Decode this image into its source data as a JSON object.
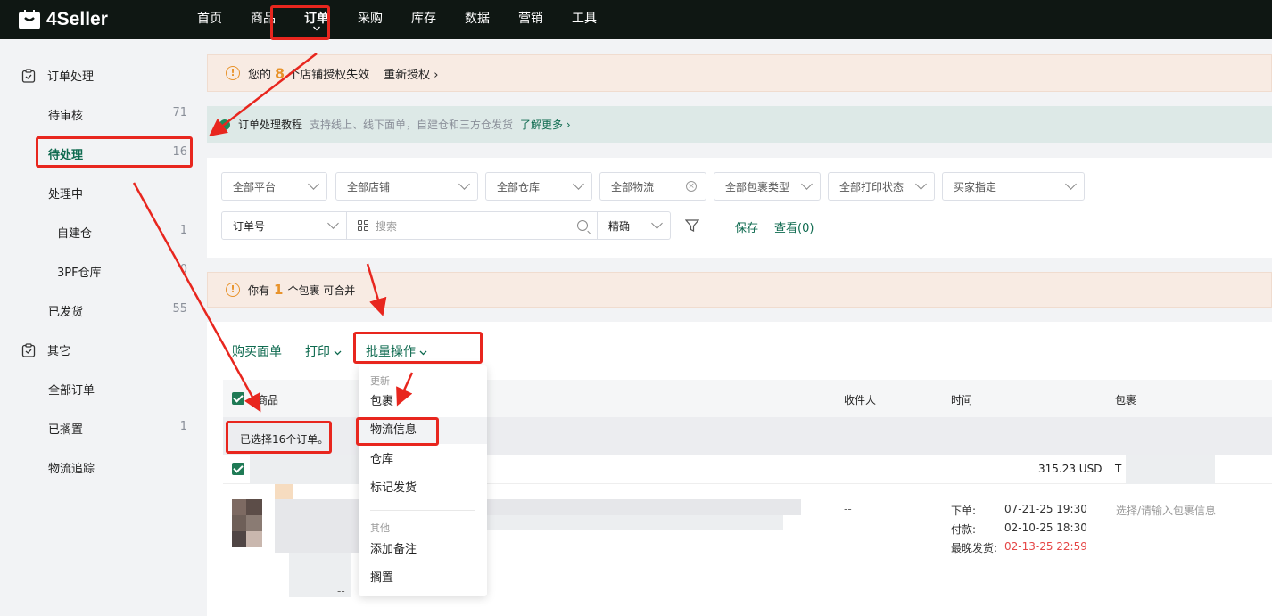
{
  "app": {
    "logo_text": "4Seller"
  },
  "nav": {
    "items": [
      "首页",
      "商品",
      "订单",
      "采购",
      "库存",
      "数据",
      "营销",
      "工具"
    ],
    "active_index": 2
  },
  "sidebar": {
    "group1": "订单处理",
    "items1": [
      {
        "label": "待审核",
        "count": "71"
      },
      {
        "label": "待处理",
        "count": "16"
      },
      {
        "label": "处理中",
        "count": ""
      },
      {
        "label": "自建仓",
        "count": "1"
      },
      {
        "label": "3PF仓库",
        "count": "0"
      },
      {
        "label": "已发货",
        "count": "55"
      }
    ],
    "group2": "其它",
    "items2": [
      {
        "label": "全部订单",
        "count": ""
      },
      {
        "label": "已搁置",
        "count": "1"
      },
      {
        "label": "物流追踪",
        "count": ""
      }
    ]
  },
  "banner_auth": {
    "prefix": "您的",
    "number": "8",
    "suffix": "个店铺授权失效",
    "link": "重新授权 ›"
  },
  "banner_tutorial": {
    "title": "订单处理教程",
    "subtitle": "支持线上、线下面单，自建仓和三方仓发货",
    "link": "了解更多 ›"
  },
  "filters": {
    "platform": "全部平台",
    "store": "全部店铺",
    "warehouse": "全部仓库",
    "logistics": "全部物流",
    "package_type": "全部包裹类型",
    "print_status": "全部打印状态",
    "buyer_specified": "买家指定",
    "search_field": "订单号",
    "search_placeholder": "搜索",
    "match_mode": "精确",
    "save": "保存",
    "view": "查看(0)"
  },
  "banner_merge": {
    "prefix": "你有",
    "number": "1",
    "suffix": "个包裹 可合并"
  },
  "actions": {
    "buy_label": "购买面单",
    "print": "打印",
    "batch": "批量操作"
  },
  "table": {
    "headers": {
      "product": "商品",
      "recipient": "收件人",
      "time": "时间",
      "package": "包裹"
    },
    "selected_note": "已选择16个订单。",
    "order": {
      "amount": "315.23 USD",
      "amount_tail": "T",
      "recipient": "--",
      "product_tail": "--",
      "time_labels": [
        "下单:",
        "付款:",
        "最晚发货:"
      ],
      "time_values": [
        "07-21-25 19:30",
        "02-10-25 18:30",
        "02-13-25 22:59"
      ],
      "package_info": "选择/请输入包裹信息"
    }
  },
  "batch_menu": {
    "group_update": "更新",
    "update_items": [
      "包裹",
      "物流信息",
      "仓库",
      "标记发货"
    ],
    "group_other": "其他",
    "other_items": [
      "添加备注",
      "搁置"
    ]
  },
  "colors": {
    "brand": "#0e6a4f",
    "annotation_red": "#e8261e",
    "warning": "#e8932c",
    "deadline": "#e54545"
  }
}
